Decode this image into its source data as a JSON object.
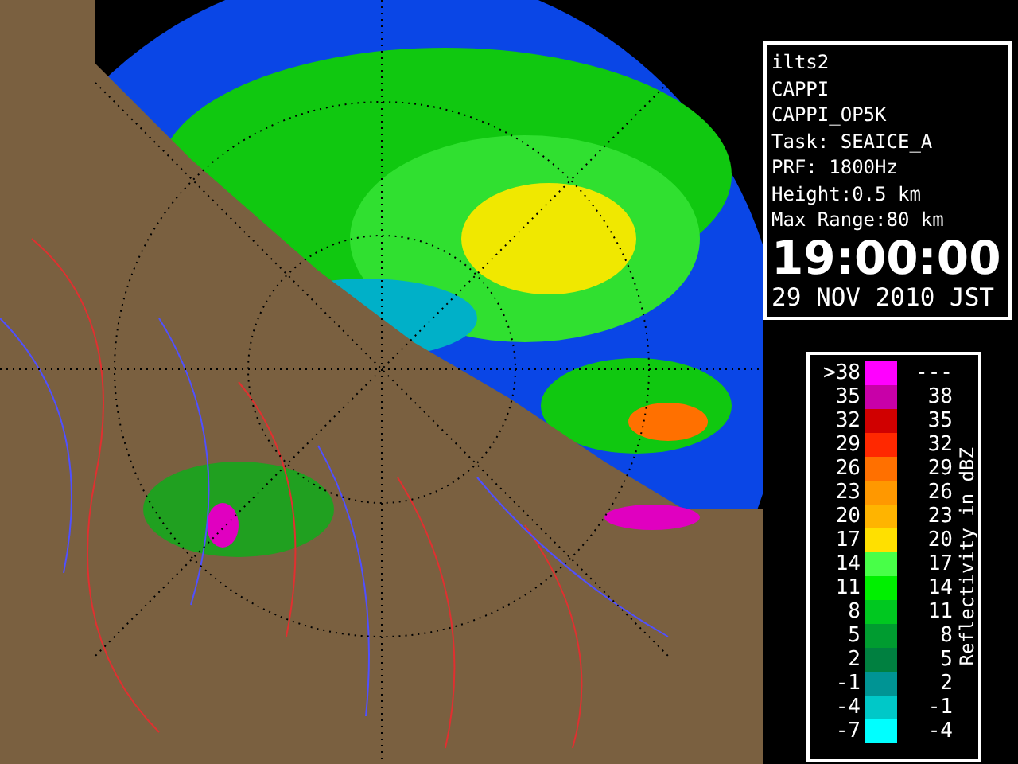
{
  "info_panel": {
    "lines": [
      "ilts2",
      "CAPPI",
      "CAPPI_OP5K",
      "Task: SEAICE_A",
      "PRF: 1800Hz",
      "Height:0.5 km",
      "Max Range:80 km"
    ],
    "time": "19:00:00",
    "date": "29 NOV 2010 JST"
  },
  "legend": {
    "title": "Reflectivity in dBZ",
    "rows": [
      {
        "low": ">38",
        "high": "---",
        "color": "#ff00ff"
      },
      {
        "low": "35",
        "high": "38",
        "color": "#c800a8"
      },
      {
        "low": "32",
        "high": "35",
        "color": "#d00000"
      },
      {
        "low": "29",
        "high": "32",
        "color": "#ff2800"
      },
      {
        "low": "26",
        "high": "29",
        "color": "#ff7000"
      },
      {
        "low": "23",
        "high": "26",
        "color": "#ff9800"
      },
      {
        "low": "20",
        "high": "23",
        "color": "#ffb400"
      },
      {
        "low": "17",
        "high": "20",
        "color": "#ffe000"
      },
      {
        "low": "14",
        "high": "17",
        "color": "#48ff48"
      },
      {
        "low": "11",
        "high": "14",
        "color": "#00f000"
      },
      {
        "low": "8",
        "high": "11",
        "color": "#00c820"
      },
      {
        "low": "5",
        "high": "8",
        "color": "#009c30"
      },
      {
        "low": "2",
        "high": "5",
        "color": "#008040"
      },
      {
        "low": "-1",
        "high": "2",
        "color": "#009494"
      },
      {
        "low": "-4",
        "high": "-1",
        "color": "#00c8c8"
      },
      {
        "low": "-7",
        "high": "-4",
        "color": "#00ffff"
      }
    ]
  }
}
